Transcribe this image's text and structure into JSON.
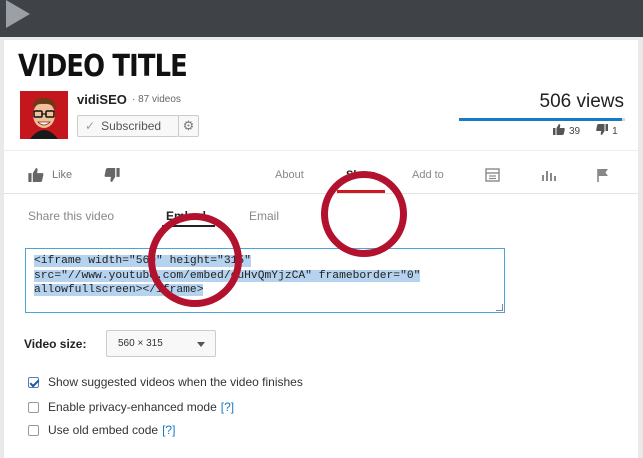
{
  "video": {
    "title": "VIDEO TITLE",
    "channel_name": "vidiSEO",
    "video_count": "· 87 videos",
    "subscribe_label": "Subscribed",
    "views": "506 views",
    "likes": "39",
    "dislikes": "1",
    "like_ratio": 0.98
  },
  "actions": {
    "like": "Like",
    "about": "About",
    "share": "Share",
    "add_to": "Add to"
  },
  "share_tabs": {
    "share_this_video": "Share this video",
    "embed": "Embed",
    "email": "Email"
  },
  "embed": {
    "line1": "<iframe width=\"560\" height=\"315\"",
    "line2": "src=\"//www.youtube.com/embed/cuHvQmYjzCA\" frameborder=\"0\"",
    "line3": "allowfullscreen></iframe>"
  },
  "video_size": {
    "label": "Video size:",
    "selected": "560 × 315"
  },
  "options": [
    {
      "label": "Show suggested videos when the video finishes",
      "checked": true,
      "help": ""
    },
    {
      "label": "Enable privacy-enhanced mode",
      "checked": false,
      "help": "[?]"
    },
    {
      "label": "Use old embed code",
      "checked": false,
      "help": "[?]"
    }
  ],
  "colors": {
    "accent_red": "#cc181e",
    "annotation_ring": "#b2122e",
    "link_blue": "#167ac6",
    "selection": "#b5d2ee"
  },
  "icons": {
    "play": "play-icon",
    "gear": "gear-icon",
    "like": "thumbs-up-icon",
    "dislike": "thumbs-down-icon",
    "transcript": "transcript-icon",
    "stats": "statistics-icon",
    "flag": "flag-icon",
    "check": "checkmark-icon"
  }
}
